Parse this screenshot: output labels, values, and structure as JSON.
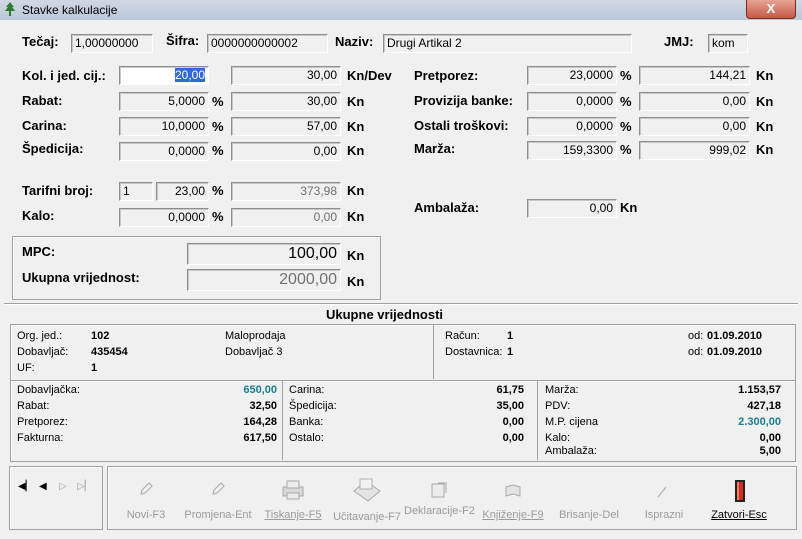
{
  "window": {
    "title": "Stavke kalkulacije",
    "close": "X"
  },
  "header": {
    "tecaj_label": "Tečaj:",
    "tecaj": "1,00000000",
    "sifra_label": "Šifra:",
    "sifra": "0000000000002",
    "naziv_label": "Naziv:",
    "naziv": "Drugi Artikal 2",
    "jmj_label": "JMJ:",
    "jmj": "kom"
  },
  "left": {
    "kol_label": "Kol. i jed. cij.:",
    "kol": "20,00",
    "cij": "30,00",
    "cij_unit": "Kn/Dev",
    "rabat_label": "Rabat:",
    "rabat_pct": "5,0000",
    "rabat_kn": "30,00",
    "carina_label": "Carina:",
    "carina_pct": "10,0000",
    "carina_kn": "57,00",
    "spedicija_label": "Špedicija:",
    "spedicija_pct": "0,0000",
    "spedicija_kn": "0,00",
    "tarifni_label": "Tarifni broj:",
    "tarifni_br": "1",
    "tarifni_pct": "23,00",
    "tarifni_kn": "373,98",
    "kalo_label": "Kalo:",
    "kalo_pct": "0,0000",
    "kalo_kn": "0,00",
    "pct": "%",
    "kn": "Kn"
  },
  "right": {
    "pretporez_label": "Pretporez:",
    "pretporez_pct": "23,0000",
    "pretporez_kn": "144,21",
    "provizija_label": "Provizija banke:",
    "provizija_pct": "0,0000",
    "provizija_kn": "0,00",
    "ostali_label": "Ostali troškovi:",
    "ostali_pct": "0,0000",
    "ostali_kn": "0,00",
    "marza_label": "Marža:",
    "marza_pct": "159,3300",
    "marza_kn": "999,02",
    "ambalaza_label": "Ambalaža:",
    "ambalaza": "0,00"
  },
  "mpc": {
    "mpc_label": "MPC:",
    "mpc": "100,00",
    "ukupna_label": "Ukupna vrijednost:",
    "ukupna": "2000,00"
  },
  "summary": {
    "title": "Ukupne vrijednosti",
    "org_label": "Org. jed.:",
    "org": "102",
    "maloprodaja": "Maloprodaja",
    "dob_label": "Dobavljač:",
    "dob": "435454",
    "dob_name": "Dobavljač 3",
    "uf_label": "UF:",
    "uf": "1",
    "racun_label": "Račun:",
    "racun": "1",
    "racun_od": "od:",
    "racun_date": "01.09.2010",
    "dostavnica_label": "Dostavnica:",
    "dostavnica": "1",
    "dost_od": "od:",
    "dost_date": "01.09.2010",
    "col1": [
      {
        "label": "Dobavljačka:",
        "value": "650,00"
      },
      {
        "label": "Rabat:",
        "value": "32,50"
      },
      {
        "label": "Pretporez:",
        "value": "164,28"
      },
      {
        "label": "Fakturna:",
        "value": "617,50"
      }
    ],
    "col2": [
      {
        "label": "Carina:",
        "value": "61,75"
      },
      {
        "label": "Špedicija:",
        "value": "35,00"
      },
      {
        "label": "Banka:",
        "value": "0,00"
      },
      {
        "label": "Ostalo:",
        "value": "0,00"
      }
    ],
    "col3": [
      {
        "label": "Marža:",
        "value": "1.153,57"
      },
      {
        "label": "PDV:",
        "value": "427,18"
      },
      {
        "label": "M.P. cijena",
        "value": "2.300,00"
      },
      {
        "label": "Kalo:",
        "value": "0,00"
      },
      {
        "label": "Ambalaža:",
        "value": "5,00"
      }
    ]
  },
  "toolbar": {
    "novi": "Novi-F3",
    "promjena": "Promjena-Ent",
    "tiskanje": "Tiskanje-F5",
    "ucitavanje": "Učitavanje-F7",
    "deklaracije": "Deklaracije-F2",
    "knjizenje": "Knjiženje-F9",
    "brisanje": "Brisanje-Del",
    "isprazni": "Isprazni",
    "zatvori": "Zatvori-Esc"
  },
  "colors": {
    "accent": "#1c7c8c",
    "selection": "#3168d5",
    "close": "#c75a46"
  }
}
